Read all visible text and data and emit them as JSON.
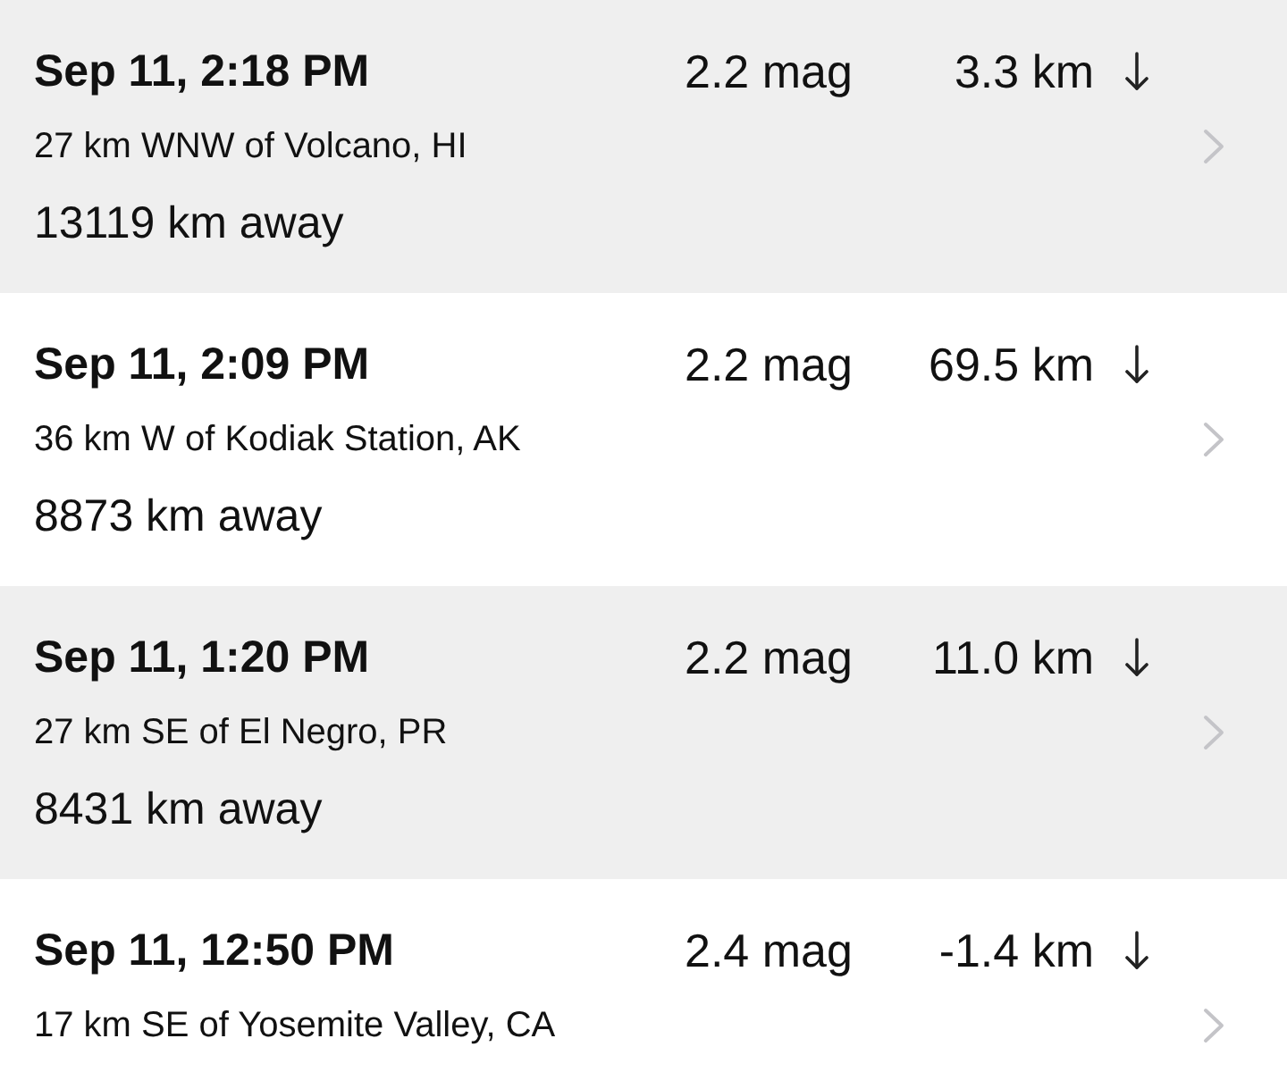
{
  "earthquakes": [
    {
      "time": "Sep 11, 2:18 PM",
      "magnitude": "2.2 mag",
      "depth": "3.3 km",
      "location": "27 km WNW of Volcano, HI",
      "distance": "13119 km away"
    },
    {
      "time": "Sep 11, 2:09 PM",
      "magnitude": "2.2 mag",
      "depth": "69.5 km",
      "location": "36 km W of Kodiak Station, AK",
      "distance": "8873 km away"
    },
    {
      "time": "Sep 11, 1:20 PM",
      "magnitude": "2.2 mag",
      "depth": "11.0 km",
      "location": "27 km SE of El Negro, PR",
      "distance": "8431 km away"
    },
    {
      "time": "Sep 11, 12:50 PM",
      "magnitude": "2.4 mag",
      "depth": "-1.4 km",
      "location": "17 km SE of Yosemite Valley, CA"
    }
  ]
}
